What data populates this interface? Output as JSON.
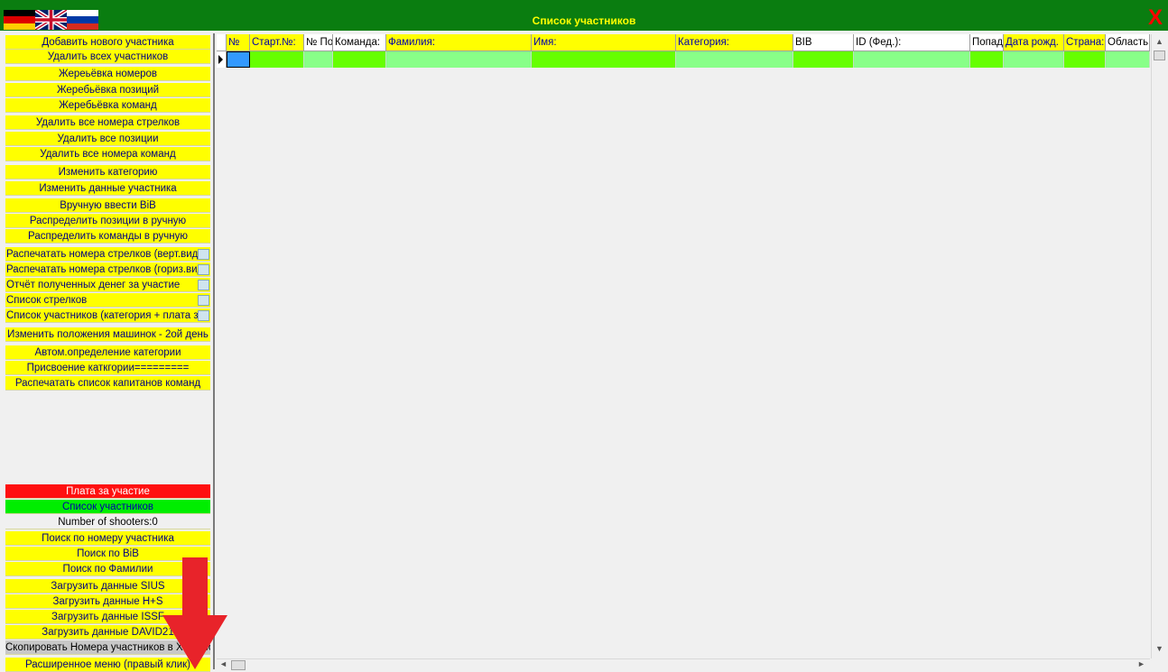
{
  "window": {
    "title": "Список участников",
    "close_label": "X"
  },
  "sidebar": {
    "buttons": [
      "Добавить нового участника",
      "Удалить всех участников",
      "Жереьёвка номеров",
      "Жеребьёвка позиций",
      "Жеребьёвка команд",
      "Удалить все номера стрелков",
      "Удалить все позиции",
      "Удалить все номера команд",
      "Изменить категорию",
      "Изменить данные участника",
      "Вручную ввести BiB",
      "Распределить позиции в ручную",
      "Распределить команды в ручную",
      "Распечатать номера стрелков (верт.вид)",
      "Распечатать номера стрелков (гориз.вид)",
      "Отчёт полученных денег за участие",
      "Список стрелков",
      "Список участников (категория + плата за",
      "Изменить положения машинок - 2ой день",
      "Автом.определение категории",
      "Присвоение каткгории=========",
      "Распечатать список капитанов команд"
    ],
    "fee_button": "Плата за участие",
    "list_button": "Список участников",
    "shooters_count": "Number of shooters:0",
    "bottom_buttons": [
      "Поиск по номеру участника",
      "Поиск по BiB",
      "Поиск по Фамилии",
      "Загрузить данные SIUS",
      "Загрузить данные H+S",
      "Загрузить данные ISSF",
      "Загрузить данные DAVID21",
      "Скопировать Номера участников в XML формат",
      "Расширенное меню (правый клик)"
    ]
  },
  "grid": {
    "columns": [
      "№",
      "Старт.№:",
      "№ По",
      "Команда:",
      "Фамилия:",
      "Имя:",
      "Категория:",
      "BIB",
      "ID (Фед.):",
      "Попад",
      "Дата рожд.",
      "Страна:",
      "Область:"
    ]
  },
  "colors": {
    "titlebar": "#0a7d10",
    "title_text": "#ffff00",
    "button_bg": "#ffff00",
    "button_text": "#000080",
    "fee_bg": "#ff1010",
    "list_bg": "#00ee00",
    "row_green_1": "#66ff00",
    "row_green_2": "#88ff88",
    "selected_cell": "#3399ff",
    "annotation_arrow": "#e8232a"
  }
}
